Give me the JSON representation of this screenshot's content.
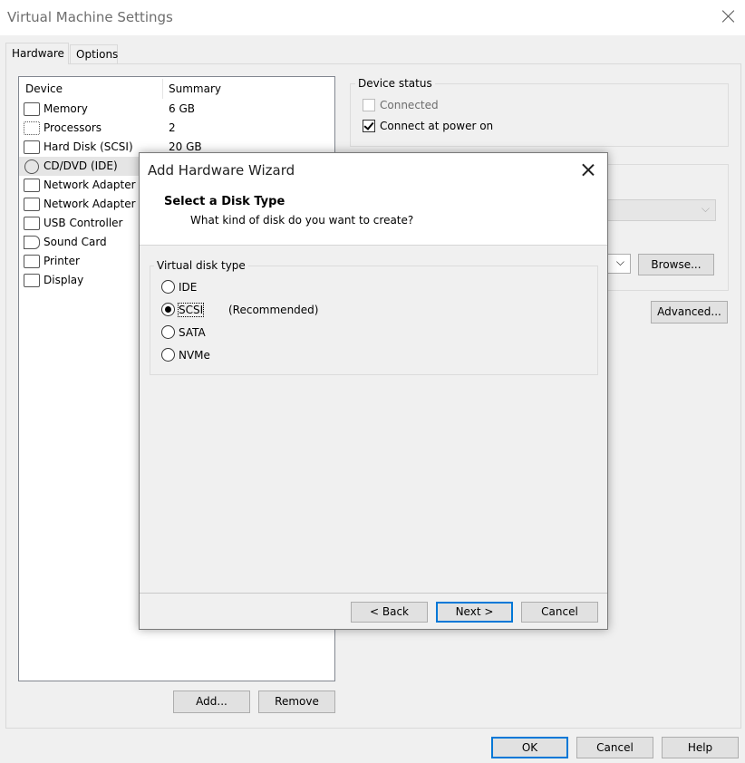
{
  "window": {
    "title": "Virtual Machine Settings"
  },
  "tabs": [
    {
      "label": "Hardware"
    },
    {
      "label": "Options"
    }
  ],
  "device_list": {
    "columns": {
      "device": "Device",
      "summary": "Summary"
    },
    "items": [
      {
        "name": "Memory",
        "summary": "6 GB",
        "icon": "memory-icon"
      },
      {
        "name": "Processors",
        "summary": "2",
        "icon": "processor-icon"
      },
      {
        "name": "Hard Disk (SCSI)",
        "summary": "20 GB",
        "icon": "hard-disk-icon"
      },
      {
        "name": "CD/DVD (IDE)",
        "summary": "",
        "icon": "cd-dvd-icon"
      },
      {
        "name": "Network Adapter",
        "summary": "",
        "icon": "network-adapter-icon"
      },
      {
        "name": "Network Adapter 2",
        "summary": "",
        "icon": "network-adapter-icon"
      },
      {
        "name": "USB Controller",
        "summary": "",
        "icon": "usb-icon"
      },
      {
        "name": "Sound Card",
        "summary": "",
        "icon": "speaker-icon"
      },
      {
        "name": "Printer",
        "summary": "",
        "icon": "printer-icon"
      },
      {
        "name": "Display",
        "summary": "",
        "icon": "monitor-icon"
      }
    ],
    "add_label": "Add...",
    "remove_label": "Remove"
  },
  "device_status": {
    "label": "Device status",
    "connected_label": "Connected",
    "connected_checked": false,
    "connect_power_label": "Connect at power on",
    "connect_power_checked": true
  },
  "connection": {
    "browse_label": "Browse...",
    "advanced_label": "Advanced..."
  },
  "wizard": {
    "title": "Add Hardware Wizard",
    "heading": "Select a Disk Type",
    "subheading": "What kind of disk do you want to create?",
    "group_label": "Virtual disk type",
    "options": [
      {
        "label": "IDE",
        "note": "",
        "selected": false
      },
      {
        "label": "SCSI",
        "note": "(Recommended)",
        "selected": true
      },
      {
        "label": "SATA",
        "note": "",
        "selected": false
      },
      {
        "label": "NVMe",
        "note": "",
        "selected": false
      }
    ],
    "back_label": "< Back",
    "next_label": "Next >",
    "cancel_label": "Cancel"
  },
  "footer": {
    "ok_label": "OK",
    "cancel_label": "Cancel",
    "help_label": "Help"
  },
  "colors": {
    "accent": "#0078d7",
    "selection": "#e5e5e5"
  }
}
